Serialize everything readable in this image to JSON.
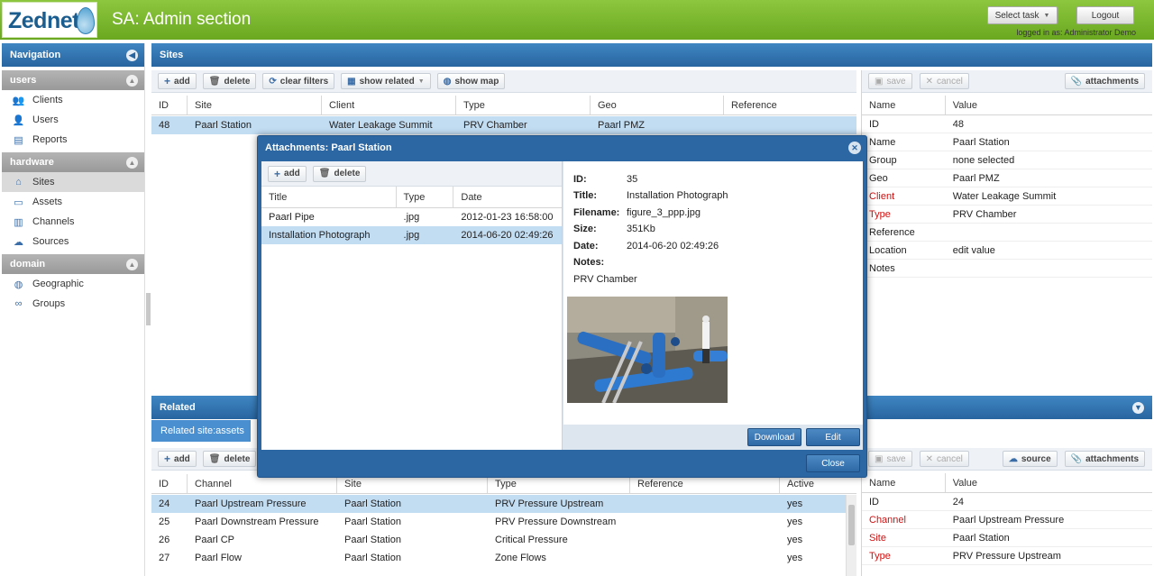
{
  "app": {
    "logo": "Zednet",
    "title": "SA: Admin section",
    "select_task": "Select task",
    "logout": "Logout",
    "logged_in": "logged in as: Administrator Demo"
  },
  "navigation": {
    "title": "Navigation",
    "groups": [
      {
        "label": "users",
        "items": [
          {
            "label": "Clients",
            "icon": "users-icon"
          },
          {
            "label": "Users",
            "icon": "user-icon"
          },
          {
            "label": "Reports",
            "icon": "report-icon"
          }
        ]
      },
      {
        "label": "hardware",
        "items": [
          {
            "label": "Sites",
            "icon": "home-icon"
          },
          {
            "label": "Assets",
            "icon": "laptop-icon"
          },
          {
            "label": "Channels",
            "icon": "bar-chart-icon"
          },
          {
            "label": "Sources",
            "icon": "cloud-icon"
          }
        ]
      },
      {
        "label": "domain",
        "items": [
          {
            "label": "Geographic",
            "icon": "globe-icon"
          },
          {
            "label": "Groups",
            "icon": "link-icon"
          }
        ]
      }
    ]
  },
  "sites": {
    "title": "Sites",
    "toolbar": {
      "add": "add",
      "delete": "delete",
      "clear_filters": "clear filters",
      "show_related": "show related",
      "show_map": "show map"
    },
    "columns": [
      "ID",
      "Site",
      "Client",
      "Type",
      "Geo",
      "Reference"
    ],
    "rows": [
      [
        "48",
        "Paarl Station",
        "Water Leakage Summit",
        "PRV Chamber",
        "Paarl PMZ",
        ""
      ]
    ]
  },
  "site_props": {
    "toolbar": {
      "save": "save",
      "cancel": "cancel",
      "attachments": "attachments"
    },
    "columns": [
      "Name",
      "Value"
    ],
    "rows": [
      {
        "name": "ID",
        "value": "48",
        "required": false
      },
      {
        "name": "Name",
        "value": "Paarl Station",
        "required": false
      },
      {
        "name": "Group",
        "value": "none selected",
        "required": false
      },
      {
        "name": "Geo",
        "value": "Paarl PMZ",
        "required": false
      },
      {
        "name": "Client",
        "value": "Water Leakage Summit",
        "required": true
      },
      {
        "name": "Type",
        "value": "PRV Chamber",
        "required": true
      },
      {
        "name": "Reference",
        "value": "",
        "required": false
      },
      {
        "name": "Location",
        "value": "edit value",
        "required": false
      },
      {
        "name": "Notes",
        "value": "",
        "required": false
      }
    ]
  },
  "related": {
    "title": "Related",
    "tab": "Related site:assets",
    "toolbar": {
      "add": "add",
      "delete": "delete"
    },
    "columns": [
      "ID",
      "Channel",
      "Site",
      "Type",
      "Reference",
      "Active"
    ],
    "rows": [
      [
        "24",
        "Paarl Upstream Pressure",
        "Paarl Station",
        "PRV Pressure Upstream",
        "",
        "yes"
      ],
      [
        "25",
        "Paarl Downstream Pressure",
        "Paarl Station",
        "PRV Pressure Downstream",
        "",
        "yes"
      ],
      [
        "26",
        "Paarl CP",
        "Paarl Station",
        "Critical Pressure",
        "",
        "yes"
      ],
      [
        "27",
        "Paarl Flow",
        "Paarl Station",
        "Zone Flows",
        "",
        "yes"
      ]
    ]
  },
  "related_props": {
    "toolbar": {
      "save": "save",
      "cancel": "cancel",
      "source": "source",
      "attachments": "attachments"
    },
    "columns": [
      "Name",
      "Value"
    ],
    "rows": [
      {
        "name": "ID",
        "value": "24",
        "required": false
      },
      {
        "name": "Channel",
        "value": "Paarl Upstream Pressure",
        "required": true
      },
      {
        "name": "Site",
        "value": "Paarl Station",
        "required": true
      },
      {
        "name": "Type",
        "value": "PRV Pressure Upstream",
        "required": true
      }
    ]
  },
  "modal": {
    "title": "Attachments: Paarl Station",
    "toolbar": {
      "add": "add",
      "delete": "delete"
    },
    "columns": [
      "Title",
      "Type",
      "Date"
    ],
    "rows": [
      [
        "Paarl Pipe",
        ".jpg",
        "2012-01-23 16:58:00"
      ],
      [
        "Installation Photograph",
        ".jpg",
        "2014-06-20 02:49:26"
      ]
    ],
    "detail": {
      "id_label": "ID:",
      "id": "35",
      "title_label": "Title:",
      "title": "Installation Photograph",
      "filename_label": "Filename:",
      "filename": "figure_3_ppp.jpg",
      "size_label": "Size:",
      "size": "351Kb",
      "date_label": "Date:",
      "date": "2014-06-20 02:49:26",
      "notes_label": "Notes:",
      "notes": "PRV Chamber"
    },
    "download": "Download",
    "edit": "Edit",
    "close": "Close"
  }
}
